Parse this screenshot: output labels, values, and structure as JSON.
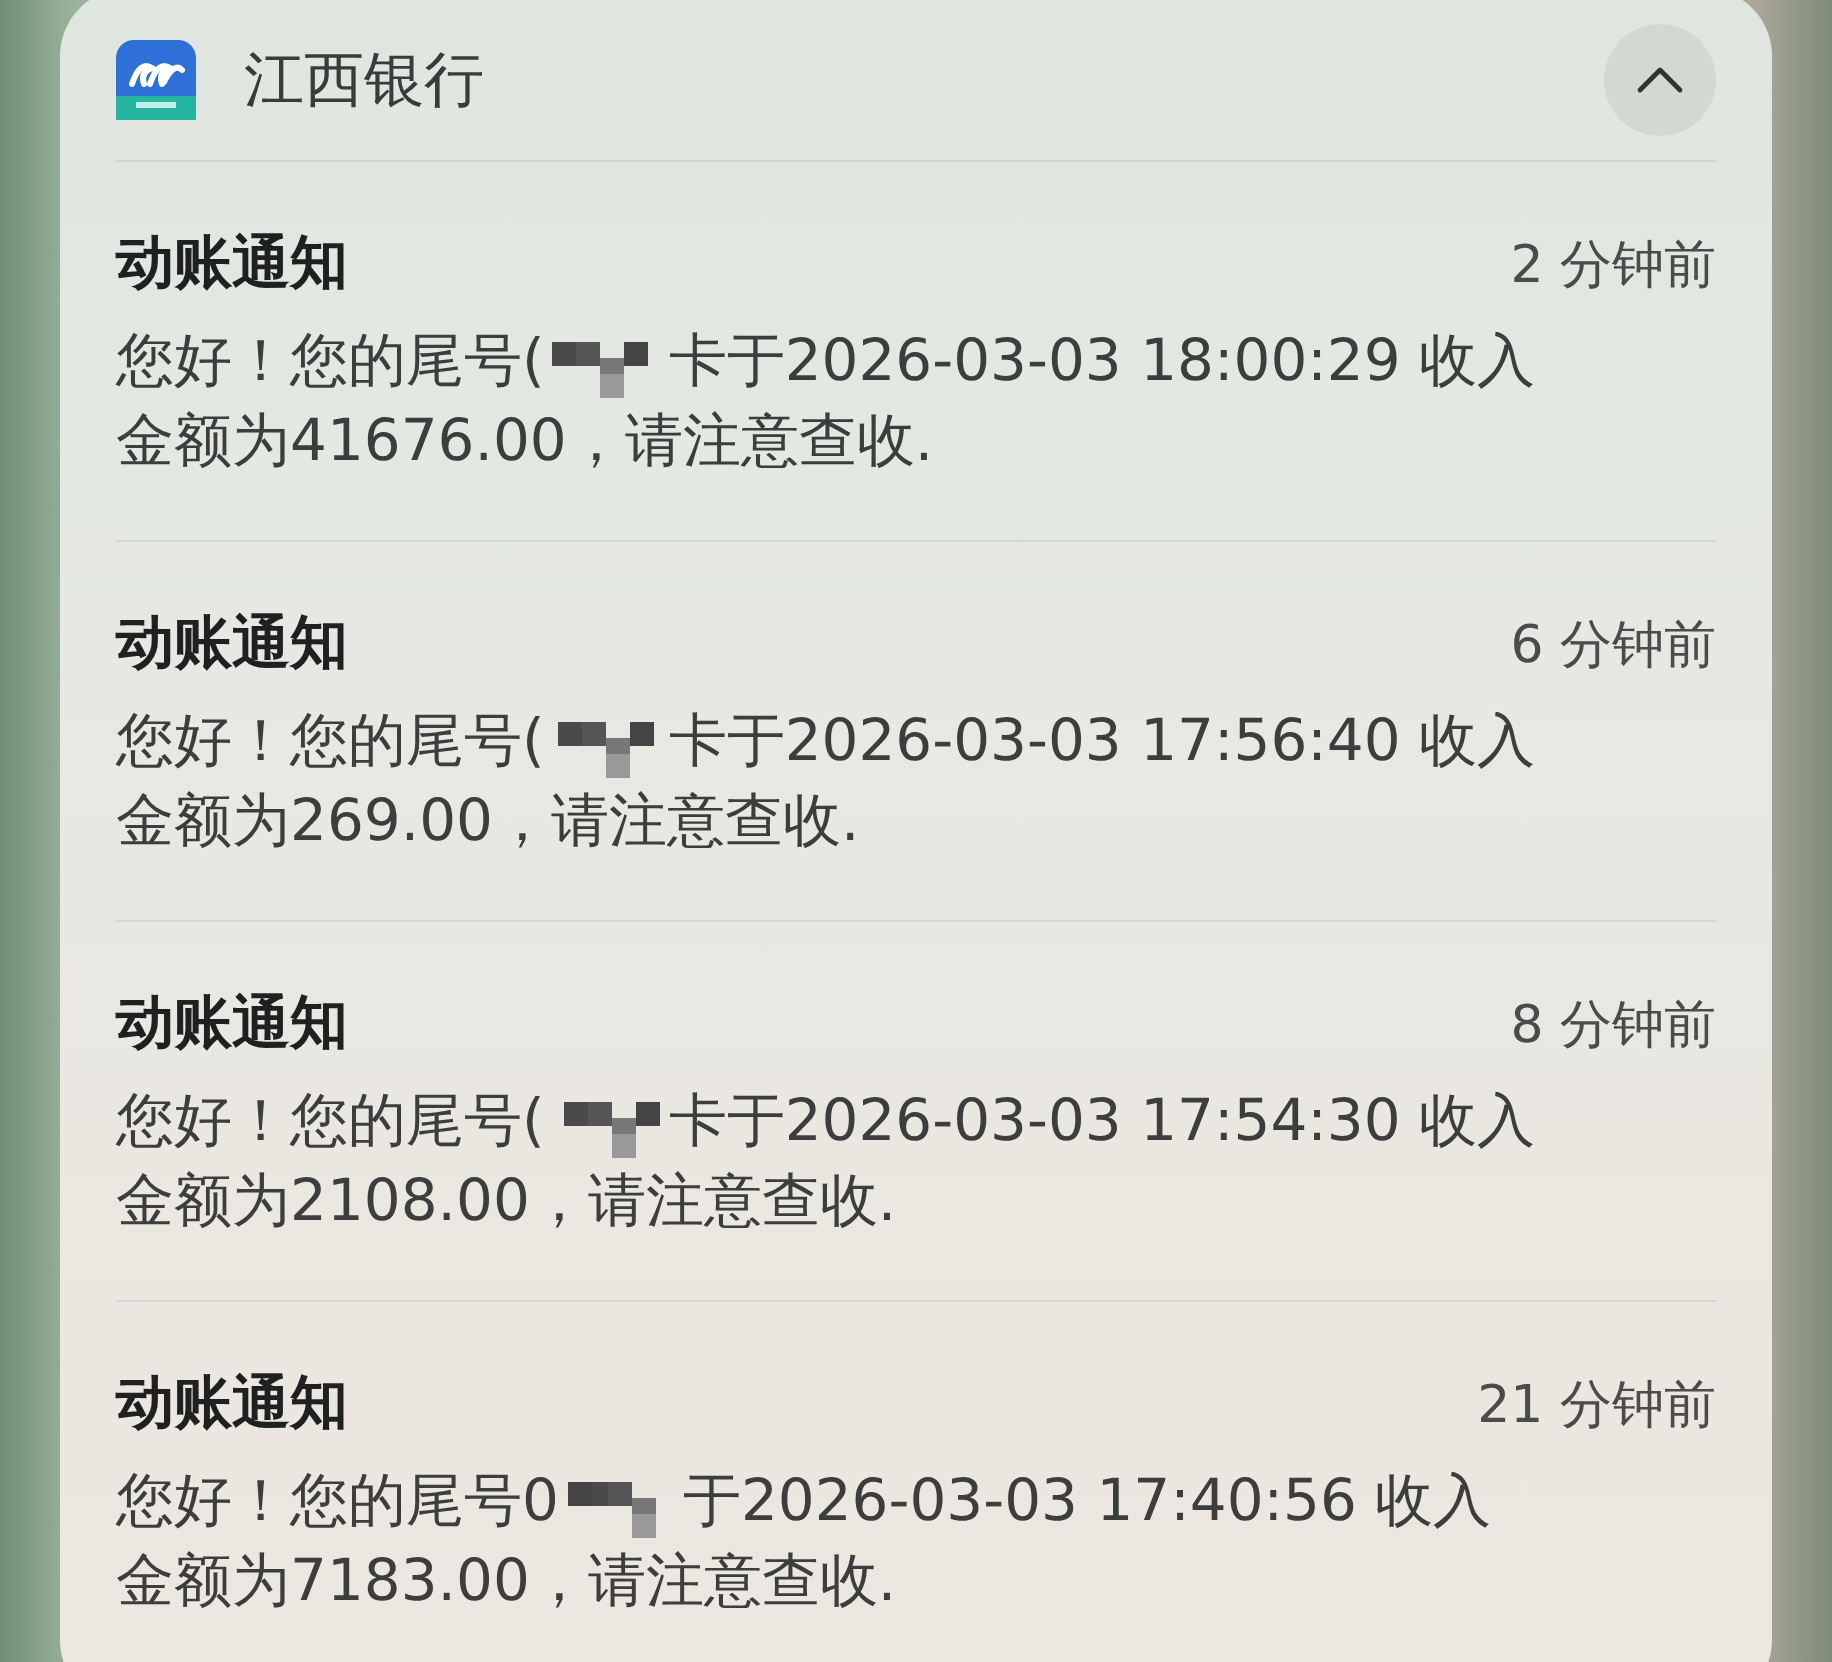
{
  "app": {
    "name": "江西银行",
    "expanded": true
  },
  "notifications": [
    {
      "title": "动账通知",
      "time": "2 分钟前",
      "line_1_start": "您好！您的尾号(",
      "line_1_end": "卡于2026-03-03 18:00:29 收入",
      "line_2": "金额为41676.00，请注意查收."
    },
    {
      "title": "动账通知",
      "time": "6 分钟前",
      "line_1_start": "您好！您的尾号(",
      "line_1_end": "卡于2026-03-03 17:56:40 收入",
      "line_2": "金额为269.00，请注意查收."
    },
    {
      "title": "动账通知",
      "time": "8 分钟前",
      "line_1_start": "您好！您的尾号(",
      "line_1_end": "卡于2026-03-03 17:54:30 收入",
      "line_2": "金额为2108.00，请注意查收."
    },
    {
      "title": "动账通知",
      "time": "21 分钟前",
      "line_1_start": "您好！您的尾号0",
      "line_1_end": "于2026-03-03 17:40:56 收入",
      "line_2": "金额为7183.00，请注意查收."
    }
  ]
}
